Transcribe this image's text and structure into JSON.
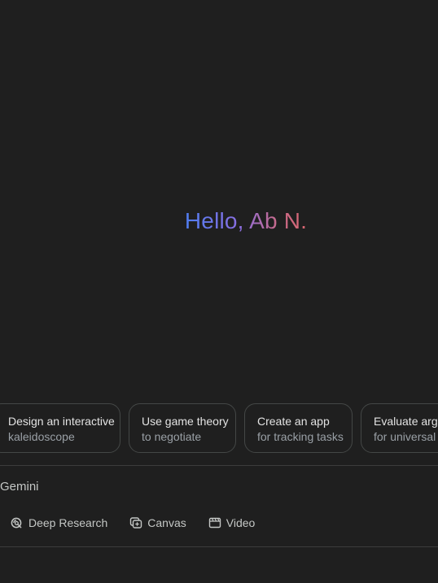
{
  "greeting": "Hello, Ab N.",
  "suggestions": [
    {
      "title": "Design an interactive",
      "subtitle": "kaleidoscope"
    },
    {
      "title": "Use game theory",
      "subtitle": "to negotiate"
    },
    {
      "title": "Create an app",
      "subtitle": "for tracking tasks"
    },
    {
      "title": "Evaluate argu",
      "subtitle": "for universal h"
    }
  ],
  "input": {
    "placeholder": "Gemini"
  },
  "tools": [
    {
      "label": "Deep Research",
      "icon": "deep-research-icon"
    },
    {
      "label": "Canvas",
      "icon": "canvas-icon"
    },
    {
      "label": "Video",
      "icon": "video-icon"
    }
  ],
  "colors": {
    "background": "#1f1f1f",
    "greeting_gradient_start": "#4f7df0",
    "greeting_gradient_end": "#d9666f",
    "chip_border": "#444746"
  }
}
